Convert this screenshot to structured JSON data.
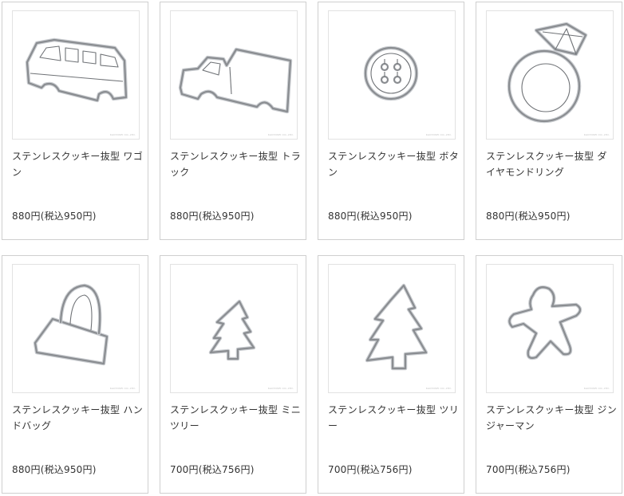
{
  "products": [
    {
      "name": "ステンレスクッキー抜型 ワゴン",
      "price": "880円(税込950円)",
      "credit": "KAOYOSHI CO.,LTD.",
      "icon": "wagon-cookie-cutter-icon"
    },
    {
      "name": "ステンレスクッキー抜型 トラック",
      "price": "880円(税込950円)",
      "credit": "KAOYOSHI CO.,LTD.",
      "icon": "truck-cookie-cutter-icon"
    },
    {
      "name": "ステンレスクッキー抜型 ボタン",
      "price": "880円(税込950円)",
      "credit": "KAOYOSHI CO.,LTD.",
      "icon": "button-cookie-cutter-icon"
    },
    {
      "name": "ステンレスクッキー抜型 ダイヤモンドリング",
      "price": "880円(税込950円)",
      "credit": "KAOYOSHI CO.,LTD.",
      "icon": "diamond-ring-cookie-cutter-icon"
    },
    {
      "name": "ステンレスクッキー抜型 ハンドバッグ",
      "price": "880円(税込950円)",
      "credit": "KAOYOSHI CO.,LTD.",
      "icon": "handbag-cookie-cutter-icon"
    },
    {
      "name": "ステンレスクッキー抜型 ミニツリー",
      "price": "700円(税込756円)",
      "credit": "KAOYOSHI CO.,LTD.",
      "icon": "mini-tree-cookie-cutter-icon"
    },
    {
      "name": "ステンレスクッキー抜型 ツリー",
      "price": "700円(税込756円)",
      "credit": "KAOYOSHI CO.,LTD.",
      "icon": "tree-cookie-cutter-icon"
    },
    {
      "name": "ステンレスクッキー抜型 ジンジャーマン",
      "price": "700円(税込756円)",
      "credit": "KAOYOSHI CO.,LTD.",
      "icon": "gingerman-cookie-cutter-icon"
    }
  ]
}
